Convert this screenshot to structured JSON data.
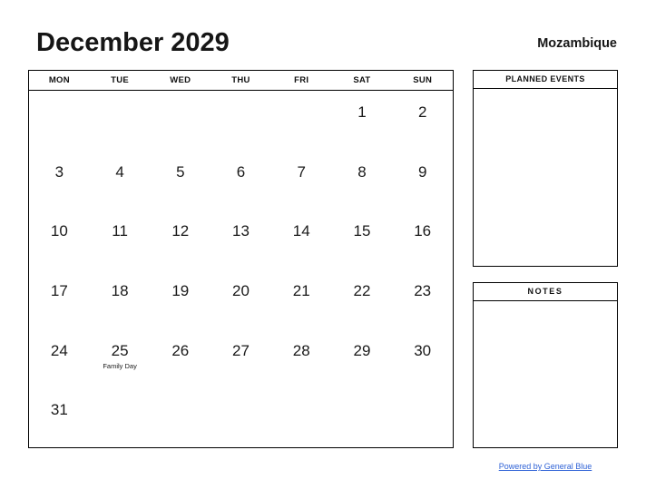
{
  "header": {
    "month_title": "December 2029",
    "country": "Mozambique"
  },
  "calendar": {
    "weekdays": [
      "MON",
      "TUE",
      "WED",
      "THU",
      "FRI",
      "SAT",
      "SUN"
    ],
    "weeks": [
      [
        {
          "day": "",
          "event": ""
        },
        {
          "day": "",
          "event": ""
        },
        {
          "day": "",
          "event": ""
        },
        {
          "day": "",
          "event": ""
        },
        {
          "day": "",
          "event": ""
        },
        {
          "day": "1",
          "event": ""
        },
        {
          "day": "2",
          "event": ""
        }
      ],
      [
        {
          "day": "3",
          "event": ""
        },
        {
          "day": "4",
          "event": ""
        },
        {
          "day": "5",
          "event": ""
        },
        {
          "day": "6",
          "event": ""
        },
        {
          "day": "7",
          "event": ""
        },
        {
          "day": "8",
          "event": ""
        },
        {
          "day": "9",
          "event": ""
        }
      ],
      [
        {
          "day": "10",
          "event": ""
        },
        {
          "day": "11",
          "event": ""
        },
        {
          "day": "12",
          "event": ""
        },
        {
          "day": "13",
          "event": ""
        },
        {
          "day": "14",
          "event": ""
        },
        {
          "day": "15",
          "event": ""
        },
        {
          "day": "16",
          "event": ""
        }
      ],
      [
        {
          "day": "17",
          "event": ""
        },
        {
          "day": "18",
          "event": ""
        },
        {
          "day": "19",
          "event": ""
        },
        {
          "day": "20",
          "event": ""
        },
        {
          "day": "21",
          "event": ""
        },
        {
          "day": "22",
          "event": ""
        },
        {
          "day": "23",
          "event": ""
        }
      ],
      [
        {
          "day": "24",
          "event": ""
        },
        {
          "day": "25",
          "event": "Family Day"
        },
        {
          "day": "26",
          "event": ""
        },
        {
          "day": "27",
          "event": ""
        },
        {
          "day": "28",
          "event": ""
        },
        {
          "day": "29",
          "event": ""
        },
        {
          "day": "30",
          "event": ""
        }
      ],
      [
        {
          "day": "31",
          "event": ""
        },
        {
          "day": "",
          "event": ""
        },
        {
          "day": "",
          "event": ""
        },
        {
          "day": "",
          "event": ""
        },
        {
          "day": "",
          "event": ""
        },
        {
          "day": "",
          "event": ""
        },
        {
          "day": "",
          "event": ""
        }
      ]
    ]
  },
  "panels": {
    "planned_events_title": "PLANNED EVENTS",
    "planned_events_body": "",
    "notes_title": "NOTES",
    "notes_body": ""
  },
  "footer": {
    "powered_by": "Powered by General Blue"
  },
  "colors": {
    "link": "#2f62d6",
    "border": "#000000",
    "text": "#1a1a1a",
    "background": "#ffffff"
  }
}
